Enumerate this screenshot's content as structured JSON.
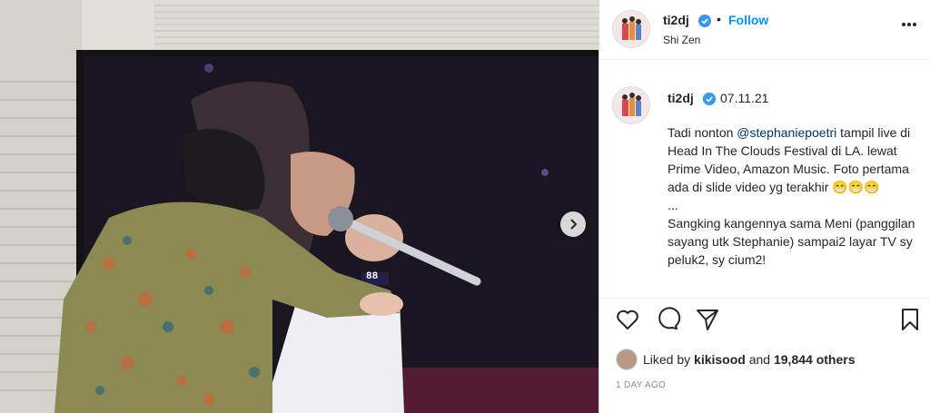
{
  "post": {
    "username": "ti2dj",
    "follow_label": "Follow",
    "separator": "•",
    "location": "Shi Zen",
    "caption_date": "07.11.21",
    "caption_before_mention": "Tadi nonton ",
    "caption_mention": "@stephaniepoetri",
    "caption_after_mention": " tampil live di Head In The Clouds Festival di LA. lewat Prime Video, Amazon Music. Foto pertama ada di slide video yg terakhir ",
    "caption_emojis": "😁😁😁",
    "caption_rest": "\n...\nSangking kangennya sama Meni (panggilan sayang utk Stephanie) sampai2 layar TV sy peluk2, sy cium2!",
    "liked_prefix": "Liked by ",
    "liked_user": "kikisood",
    "liked_mid": " and ",
    "liked_count": "19,844 others",
    "time_ago": "1 DAY AGO",
    "watch_text": "88"
  },
  "colors": {
    "accent": "#0095f6",
    "text": "#262626",
    "muted": "#8e8e8e"
  },
  "icons": [
    "verified-badge-icon",
    "more-options-icon",
    "next-slide-icon",
    "heart-icon",
    "comment-icon",
    "share-icon",
    "bookmark-icon"
  ]
}
